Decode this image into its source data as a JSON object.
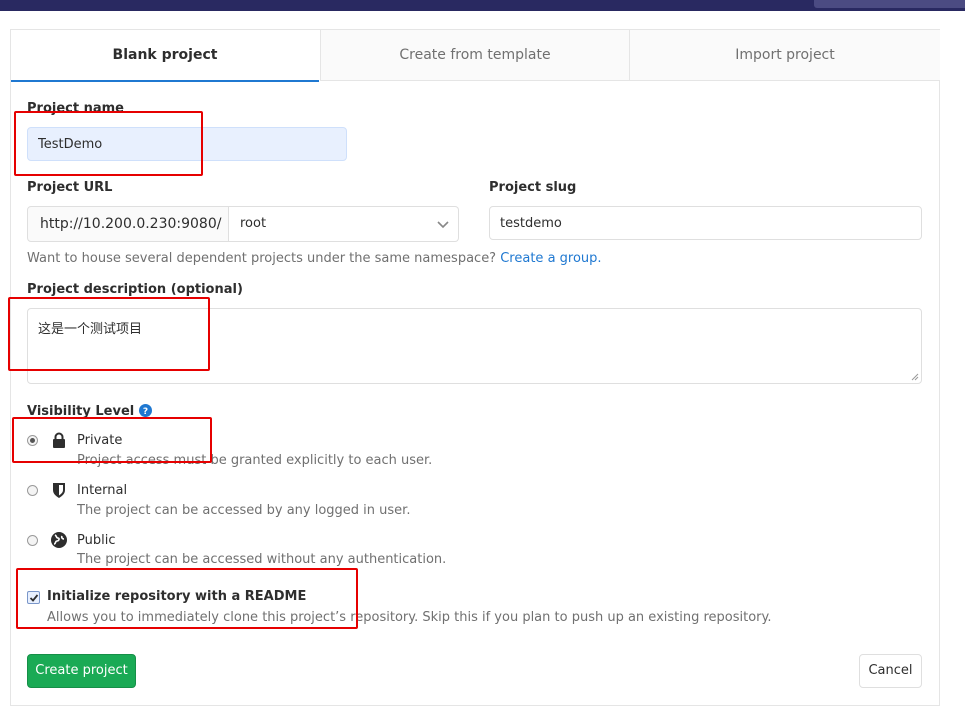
{
  "tabs": [
    "Blank project",
    "Create from template",
    "Import project"
  ],
  "project_name": {
    "label": "Project name",
    "value": "TestDemo"
  },
  "project_url": {
    "label": "Project URL",
    "prefix": "http://10.200.0.230:9080/",
    "namespace": "root"
  },
  "project_slug": {
    "label": "Project slug",
    "value": "testdemo"
  },
  "namespace_hint": {
    "text": "Want to house several dependent projects under the same namespace?",
    "link": "Create a group."
  },
  "description": {
    "label": "Project description (optional)",
    "value": "这是一个测试项目"
  },
  "visibility": {
    "label": "Visibility Level",
    "selected": "Private",
    "options": [
      {
        "name": "Private",
        "help": "Project access must be granted explicitly to each user.",
        "icon": "lock-icon"
      },
      {
        "name": "Internal",
        "help": "The project can be accessed by any logged in user.",
        "icon": "shield-icon"
      },
      {
        "name": "Public",
        "help": "The project can be accessed without any authentication.",
        "icon": "globe-icon"
      }
    ]
  },
  "readme": {
    "checked": true,
    "label": "Initialize repository with a README",
    "help": "Allows you to immediately clone this project’s repository. Skip this if you plan to push up an existing repository."
  },
  "buttons": {
    "create": "Create project",
    "cancel": "Cancel"
  },
  "colors": {
    "primary": "#1aaa55",
    "link": "#1f78d1",
    "tab_active": "#1f78d1",
    "annotation": "#e60000",
    "topbar": "#292961"
  }
}
